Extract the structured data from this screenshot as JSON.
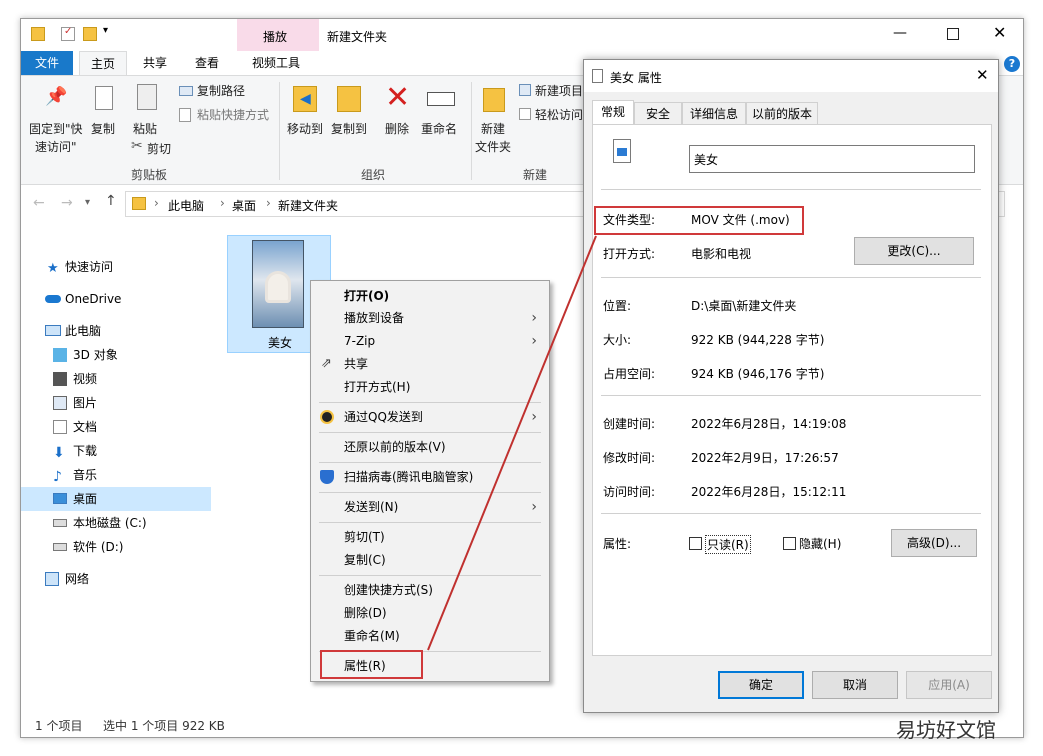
{
  "explorer": {
    "window_title": "新建文件夹",
    "context_tab": "播放",
    "tabs": [
      "文件",
      "主页",
      "共享",
      "查看",
      "视频工具"
    ],
    "ribbon": {
      "pin_label_1": "固定到\"快",
      "pin_label_2": "速访问\"",
      "copy_label": "复制",
      "paste_label": "粘贴",
      "copy_path_label": "复制路径",
      "paste_shortcut_label": "粘贴快捷方式",
      "cut_label": "剪切",
      "clipboard_group": "剪贴板",
      "move_to_label": "移动到",
      "copy_to_label": "复制到",
      "delete_label": "删除",
      "rename_label": "重命名",
      "organize_group": "组织",
      "new_folder_label_1": "新建",
      "new_folder_label_2": "文件夹",
      "new_item_label": "新建项目",
      "easy_access_label": "轻松访问",
      "new_group": "新建"
    },
    "breadcrumb": [
      "此电脑",
      "桌面",
      "新建文件夹"
    ],
    "nav": [
      {
        "label": "快速访问"
      },
      {
        "label": "OneDrive"
      },
      {
        "label": "此电脑"
      },
      {
        "label": "3D 对象"
      },
      {
        "label": "视频"
      },
      {
        "label": "图片"
      },
      {
        "label": "文档"
      },
      {
        "label": "下载"
      },
      {
        "label": "音乐"
      },
      {
        "label": "桌面"
      },
      {
        "label": "本地磁盘 (C:)"
      },
      {
        "label": "软件 (D:)"
      },
      {
        "label": "网络"
      }
    ],
    "file": {
      "name": "美女"
    },
    "status": {
      "count": "1 个项目",
      "selected": "选中 1 个项目  922 KB"
    }
  },
  "context_menu": {
    "items": [
      "打开(O)",
      "播放到设备",
      "7-Zip",
      "共享",
      "打开方式(H)",
      "通过QQ发送到",
      "还原以前的版本(V)",
      "扫描病毒(腾讯电脑管家)",
      "发送到(N)",
      "剪切(T)",
      "复制(C)",
      "创建快捷方式(S)",
      "删除(D)",
      "重命名(M)",
      "属性(R)"
    ]
  },
  "dialog": {
    "title": "美女 属性",
    "tabs": [
      "常规",
      "安全",
      "详细信息",
      "以前的版本"
    ],
    "name_value": "美女",
    "rows": {
      "type_label": "文件类型:",
      "type_value": "MOV 文件 (.mov)",
      "open_label": "打开方式:",
      "open_value": "电影和电视",
      "change_btn": "更改(C)...",
      "location_label": "位置:",
      "location_value": "D:\\桌面\\新建文件夹",
      "size_label": "大小:",
      "size_value": "922 KB (944,228 字节)",
      "disk_label": "占用空间:",
      "disk_value": "924 KB (946,176 字节)",
      "created_label": "创建时间:",
      "created_value": "2022年6月28日，14:19:08",
      "modified_label": "修改时间:",
      "modified_value": "2022年2月9日，17:26:57",
      "accessed_label": "访问时间:",
      "accessed_value": "2022年6月28日，15:12:11",
      "attr_label": "属性:",
      "readonly_label": "只读(R)",
      "hidden_label": "隐藏(H)",
      "advanced_btn": "高级(D)..."
    },
    "buttons": {
      "ok": "确定",
      "cancel": "取消",
      "apply": "应用(A)"
    }
  },
  "watermark": "易坊好文馆"
}
